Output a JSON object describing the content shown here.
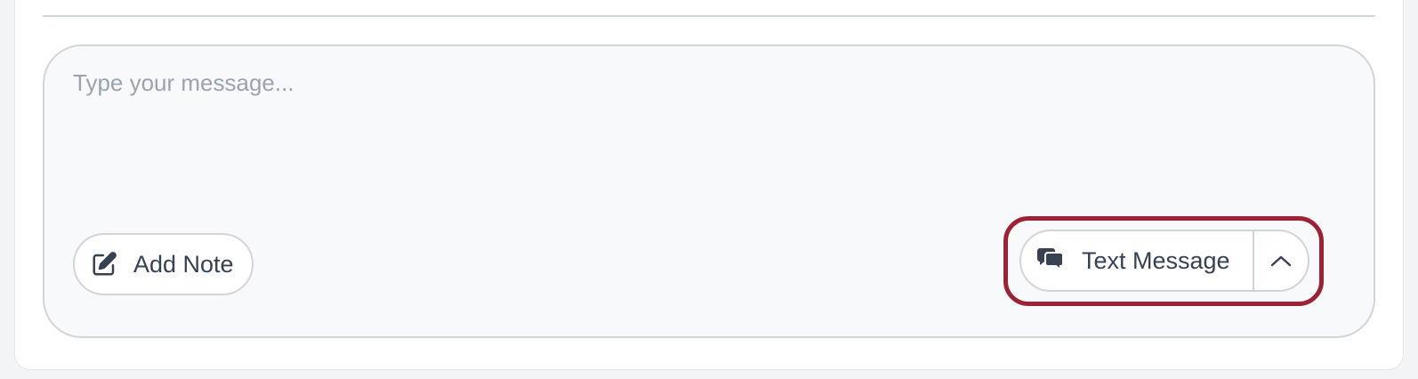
{
  "composer": {
    "message_value": "",
    "message_placeholder": "Type your message..."
  },
  "actions": {
    "add_note_label": "Add Note",
    "add_note_icon": "edit-icon",
    "send_mode_label": "Text Message",
    "send_mode_icon": "chat-bubbles-icon",
    "send_mode_toggle_icon": "chevron-up-icon"
  },
  "colors": {
    "highlight": "#9b2335",
    "border": "#d1d5db",
    "text": "#374151",
    "placeholder": "#9ca3af"
  }
}
